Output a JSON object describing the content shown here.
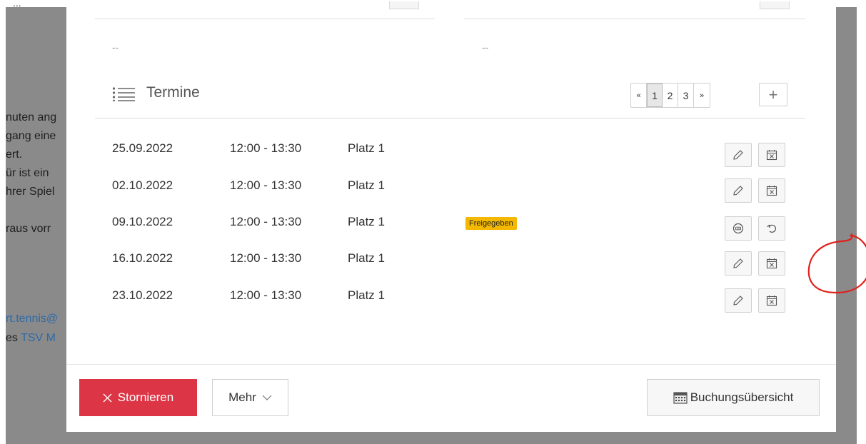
{
  "background_page": {
    "lines": [
      "nuten ang",
      "gang eine",
      "ert.",
      "ür ist ein",
      "hrer Spiel",
      "raus vorr"
    ],
    "link_line": "rt.tennis@",
    "footer_prefix": "es ",
    "footer_link": "TSV M",
    "top_dots": "..."
  },
  "modal": {
    "fields": {
      "left_value": "--",
      "right_value": "--"
    },
    "section": {
      "title": "Termine",
      "icon": "list-icon"
    },
    "pagination": {
      "prev": "«",
      "pages": [
        "1",
        "2",
        "3"
      ],
      "current_page": "1",
      "next": "»",
      "add": "+"
    },
    "appointments": [
      {
        "date": "25.09.2022",
        "time": "12:00 - 13:30",
        "court": "Platz 1",
        "status": "",
        "actions": [
          "pencil-icon",
          "calendar-cancel-icon"
        ]
      },
      {
        "date": "02.10.2022",
        "time": "12:00 - 13:30",
        "court": "Platz 1",
        "status": "",
        "actions": [
          "pencil-icon",
          "calendar-cancel-icon"
        ]
      },
      {
        "date": "09.10.2022",
        "time": "12:00 - 13:30",
        "court": "Platz 1",
        "status": "Freigegeben",
        "actions": [
          "coin-icon",
          "undo-icon"
        ]
      },
      {
        "date": "16.10.2022",
        "time": "12:00 - 13:30",
        "court": "Platz 1",
        "status": "",
        "actions": [
          "pencil-icon",
          "calendar-cancel-icon"
        ]
      },
      {
        "date": "23.10.2022",
        "time": "12:00 - 13:30",
        "court": "Platz 1",
        "status": "",
        "actions": [
          "pencil-icon",
          "calendar-cancel-icon"
        ]
      }
    ],
    "footer": {
      "cancel_label": "Stornieren",
      "more_label": "Mehr",
      "overview_label": "Buchungsübersicht"
    }
  },
  "colors": {
    "danger": "#dc3545",
    "badge": "#f4b800",
    "annotation": "#e0201c",
    "link": "#2f6aa6"
  }
}
